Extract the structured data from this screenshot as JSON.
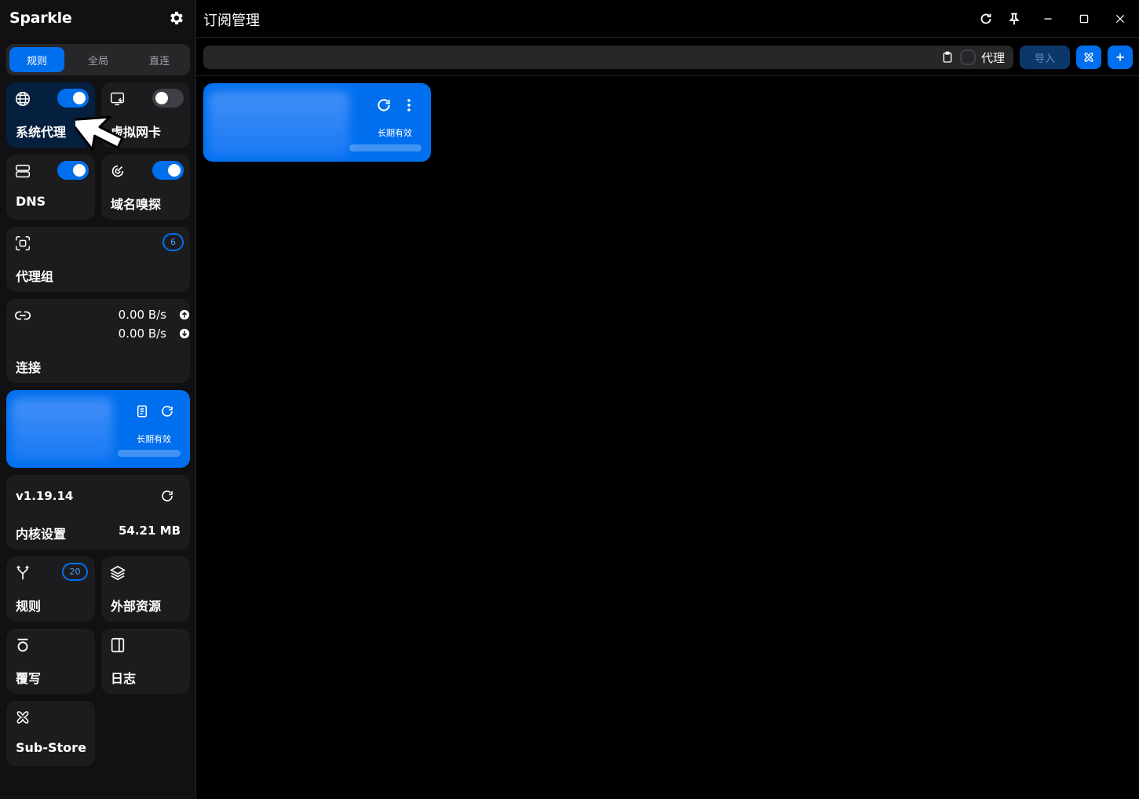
{
  "app": {
    "name": "Sparkle"
  },
  "sidebar": {
    "mode_tabs": [
      {
        "label": "规则",
        "active": true
      },
      {
        "label": "全局",
        "active": false
      },
      {
        "label": "直连",
        "active": false
      }
    ],
    "system_proxy": {
      "label": "系统代理",
      "enabled": true,
      "icon": "globe-icon"
    },
    "tun": {
      "label": "虚拟网卡",
      "enabled": false,
      "icon": "network-card-icon"
    },
    "dns": {
      "label": "DNS",
      "enabled": true,
      "icon": "server-icon"
    },
    "sniff": {
      "label": "域名嗅探",
      "enabled": true,
      "icon": "radar-icon"
    },
    "proxy_groups": {
      "label": "代理组",
      "count": "6",
      "icon": "scan-icon"
    },
    "connections": {
      "label": "连接",
      "upload": "0.00 B/s",
      "download": "0.00 B/s",
      "icon": "link-icon"
    },
    "profile": {
      "expire": "长期有效",
      "usage_fraction": 0.0
    },
    "core": {
      "version": "v1.19.14",
      "label": "内核设置",
      "memory": "54.21 MB"
    },
    "rules": {
      "label": "规则",
      "count": "20",
      "icon": "fork-icon"
    },
    "resources": {
      "label": "外部资源",
      "icon": "layers-icon"
    },
    "override": {
      "label": "覆写",
      "icon": "override-icon"
    },
    "logs": {
      "label": "日志",
      "icon": "log-panel-icon"
    },
    "substore": {
      "label": "Sub-Store",
      "icon": "substore-icon"
    }
  },
  "topbar": {
    "title": "订阅管理"
  },
  "toolbar": {
    "url_value": "",
    "proxy_checkbox_label": "代理",
    "proxy_checked": false,
    "import_label": "导入"
  },
  "subscriptions": [
    {
      "expire": "长期有效",
      "usage_fraction": 0.0
    }
  ],
  "colors": {
    "accent": "#006fee",
    "active_card": "#05203e",
    "card": "#1c1c1f",
    "sidebar_bg": "#111113"
  }
}
